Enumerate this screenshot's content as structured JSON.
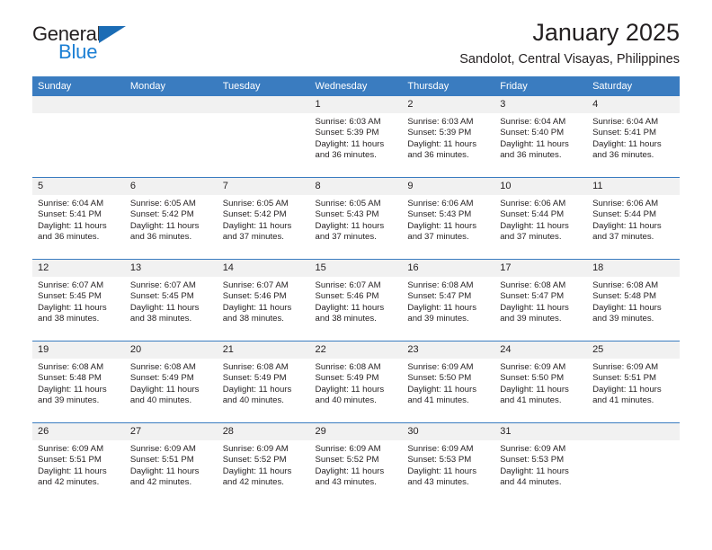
{
  "brand": {
    "name_part1": "General",
    "name_part2": "Blue",
    "logo_icon": "triangle-logo-icon"
  },
  "header": {
    "title": "January 2025",
    "subtitle": "Sandolot, Central Visayas, Philippines"
  },
  "calendar": {
    "weekday_headers": [
      "Sunday",
      "Monday",
      "Tuesday",
      "Wednesday",
      "Thursday",
      "Friday",
      "Saturday"
    ],
    "accent_color": "#3a7cc0",
    "daynum_background": "#f1f1f1",
    "weeks": [
      [
        {
          "day": "",
          "empty": true,
          "sunrise": "",
          "sunset": "",
          "daylight_line1": "",
          "daylight_line2": ""
        },
        {
          "day": "",
          "empty": true,
          "sunrise": "",
          "sunset": "",
          "daylight_line1": "",
          "daylight_line2": ""
        },
        {
          "day": "",
          "empty": true,
          "sunrise": "",
          "sunset": "",
          "daylight_line1": "",
          "daylight_line2": ""
        },
        {
          "day": "1",
          "empty": false,
          "sunrise": "Sunrise: 6:03 AM",
          "sunset": "Sunset: 5:39 PM",
          "daylight_line1": "Daylight: 11 hours",
          "daylight_line2": "and 36 minutes."
        },
        {
          "day": "2",
          "empty": false,
          "sunrise": "Sunrise: 6:03 AM",
          "sunset": "Sunset: 5:39 PM",
          "daylight_line1": "Daylight: 11 hours",
          "daylight_line2": "and 36 minutes."
        },
        {
          "day": "3",
          "empty": false,
          "sunrise": "Sunrise: 6:04 AM",
          "sunset": "Sunset: 5:40 PM",
          "daylight_line1": "Daylight: 11 hours",
          "daylight_line2": "and 36 minutes."
        },
        {
          "day": "4",
          "empty": false,
          "sunrise": "Sunrise: 6:04 AM",
          "sunset": "Sunset: 5:41 PM",
          "daylight_line1": "Daylight: 11 hours",
          "daylight_line2": "and 36 minutes."
        }
      ],
      [
        {
          "day": "5",
          "empty": false,
          "sunrise": "Sunrise: 6:04 AM",
          "sunset": "Sunset: 5:41 PM",
          "daylight_line1": "Daylight: 11 hours",
          "daylight_line2": "and 36 minutes."
        },
        {
          "day": "6",
          "empty": false,
          "sunrise": "Sunrise: 6:05 AM",
          "sunset": "Sunset: 5:42 PM",
          "daylight_line1": "Daylight: 11 hours",
          "daylight_line2": "and 36 minutes."
        },
        {
          "day": "7",
          "empty": false,
          "sunrise": "Sunrise: 6:05 AM",
          "sunset": "Sunset: 5:42 PM",
          "daylight_line1": "Daylight: 11 hours",
          "daylight_line2": "and 37 minutes."
        },
        {
          "day": "8",
          "empty": false,
          "sunrise": "Sunrise: 6:05 AM",
          "sunset": "Sunset: 5:43 PM",
          "daylight_line1": "Daylight: 11 hours",
          "daylight_line2": "and 37 minutes."
        },
        {
          "day": "9",
          "empty": false,
          "sunrise": "Sunrise: 6:06 AM",
          "sunset": "Sunset: 5:43 PM",
          "daylight_line1": "Daylight: 11 hours",
          "daylight_line2": "and 37 minutes."
        },
        {
          "day": "10",
          "empty": false,
          "sunrise": "Sunrise: 6:06 AM",
          "sunset": "Sunset: 5:44 PM",
          "daylight_line1": "Daylight: 11 hours",
          "daylight_line2": "and 37 minutes."
        },
        {
          "day": "11",
          "empty": false,
          "sunrise": "Sunrise: 6:06 AM",
          "sunset": "Sunset: 5:44 PM",
          "daylight_line1": "Daylight: 11 hours",
          "daylight_line2": "and 37 minutes."
        }
      ],
      [
        {
          "day": "12",
          "empty": false,
          "sunrise": "Sunrise: 6:07 AM",
          "sunset": "Sunset: 5:45 PM",
          "daylight_line1": "Daylight: 11 hours",
          "daylight_line2": "and 38 minutes."
        },
        {
          "day": "13",
          "empty": false,
          "sunrise": "Sunrise: 6:07 AM",
          "sunset": "Sunset: 5:45 PM",
          "daylight_line1": "Daylight: 11 hours",
          "daylight_line2": "and 38 minutes."
        },
        {
          "day": "14",
          "empty": false,
          "sunrise": "Sunrise: 6:07 AM",
          "sunset": "Sunset: 5:46 PM",
          "daylight_line1": "Daylight: 11 hours",
          "daylight_line2": "and 38 minutes."
        },
        {
          "day": "15",
          "empty": false,
          "sunrise": "Sunrise: 6:07 AM",
          "sunset": "Sunset: 5:46 PM",
          "daylight_line1": "Daylight: 11 hours",
          "daylight_line2": "and 38 minutes."
        },
        {
          "day": "16",
          "empty": false,
          "sunrise": "Sunrise: 6:08 AM",
          "sunset": "Sunset: 5:47 PM",
          "daylight_line1": "Daylight: 11 hours",
          "daylight_line2": "and 39 minutes."
        },
        {
          "day": "17",
          "empty": false,
          "sunrise": "Sunrise: 6:08 AM",
          "sunset": "Sunset: 5:47 PM",
          "daylight_line1": "Daylight: 11 hours",
          "daylight_line2": "and 39 minutes."
        },
        {
          "day": "18",
          "empty": false,
          "sunrise": "Sunrise: 6:08 AM",
          "sunset": "Sunset: 5:48 PM",
          "daylight_line1": "Daylight: 11 hours",
          "daylight_line2": "and 39 minutes."
        }
      ],
      [
        {
          "day": "19",
          "empty": false,
          "sunrise": "Sunrise: 6:08 AM",
          "sunset": "Sunset: 5:48 PM",
          "daylight_line1": "Daylight: 11 hours",
          "daylight_line2": "and 39 minutes."
        },
        {
          "day": "20",
          "empty": false,
          "sunrise": "Sunrise: 6:08 AM",
          "sunset": "Sunset: 5:49 PM",
          "daylight_line1": "Daylight: 11 hours",
          "daylight_line2": "and 40 minutes."
        },
        {
          "day": "21",
          "empty": false,
          "sunrise": "Sunrise: 6:08 AM",
          "sunset": "Sunset: 5:49 PM",
          "daylight_line1": "Daylight: 11 hours",
          "daylight_line2": "and 40 minutes."
        },
        {
          "day": "22",
          "empty": false,
          "sunrise": "Sunrise: 6:08 AM",
          "sunset": "Sunset: 5:49 PM",
          "daylight_line1": "Daylight: 11 hours",
          "daylight_line2": "and 40 minutes."
        },
        {
          "day": "23",
          "empty": false,
          "sunrise": "Sunrise: 6:09 AM",
          "sunset": "Sunset: 5:50 PM",
          "daylight_line1": "Daylight: 11 hours",
          "daylight_line2": "and 41 minutes."
        },
        {
          "day": "24",
          "empty": false,
          "sunrise": "Sunrise: 6:09 AM",
          "sunset": "Sunset: 5:50 PM",
          "daylight_line1": "Daylight: 11 hours",
          "daylight_line2": "and 41 minutes."
        },
        {
          "day": "25",
          "empty": false,
          "sunrise": "Sunrise: 6:09 AM",
          "sunset": "Sunset: 5:51 PM",
          "daylight_line1": "Daylight: 11 hours",
          "daylight_line2": "and 41 minutes."
        }
      ],
      [
        {
          "day": "26",
          "empty": false,
          "sunrise": "Sunrise: 6:09 AM",
          "sunset": "Sunset: 5:51 PM",
          "daylight_line1": "Daylight: 11 hours",
          "daylight_line2": "and 42 minutes."
        },
        {
          "day": "27",
          "empty": false,
          "sunrise": "Sunrise: 6:09 AM",
          "sunset": "Sunset: 5:51 PM",
          "daylight_line1": "Daylight: 11 hours",
          "daylight_line2": "and 42 minutes."
        },
        {
          "day": "28",
          "empty": false,
          "sunrise": "Sunrise: 6:09 AM",
          "sunset": "Sunset: 5:52 PM",
          "daylight_line1": "Daylight: 11 hours",
          "daylight_line2": "and 42 minutes."
        },
        {
          "day": "29",
          "empty": false,
          "sunrise": "Sunrise: 6:09 AM",
          "sunset": "Sunset: 5:52 PM",
          "daylight_line1": "Daylight: 11 hours",
          "daylight_line2": "and 43 minutes."
        },
        {
          "day": "30",
          "empty": false,
          "sunrise": "Sunrise: 6:09 AM",
          "sunset": "Sunset: 5:53 PM",
          "daylight_line1": "Daylight: 11 hours",
          "daylight_line2": "and 43 minutes."
        },
        {
          "day": "31",
          "empty": false,
          "sunrise": "Sunrise: 6:09 AM",
          "sunset": "Sunset: 5:53 PM",
          "daylight_line1": "Daylight: 11 hours",
          "daylight_line2": "and 44 minutes."
        },
        {
          "day": "",
          "empty": true,
          "sunrise": "",
          "sunset": "",
          "daylight_line1": "",
          "daylight_line2": ""
        }
      ]
    ]
  }
}
